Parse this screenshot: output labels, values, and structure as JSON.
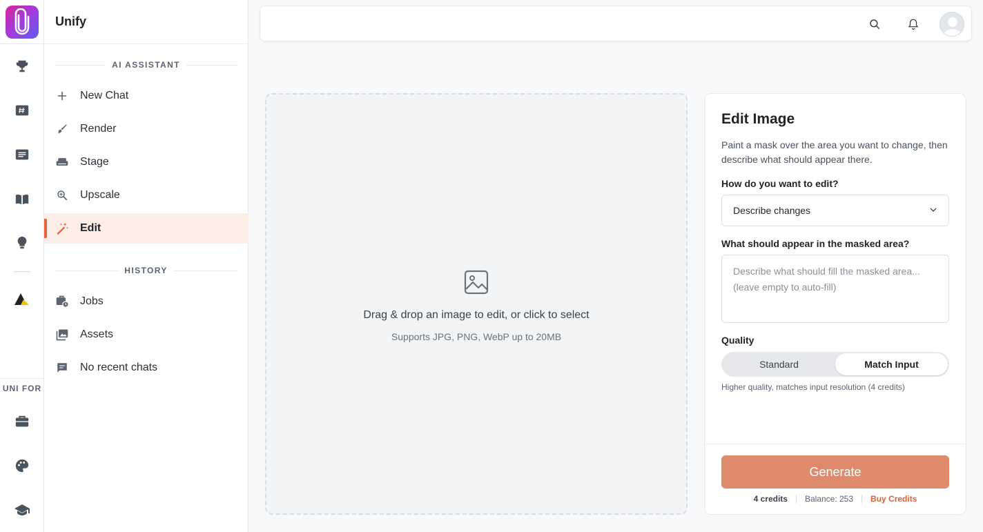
{
  "app": {
    "name": "Unify"
  },
  "rail": {
    "section_label": "UNI FOR",
    "icons": [
      "trophy-icon",
      "hashtag-card-icon",
      "news-icon",
      "book-icon",
      "lightbulb-icon",
      "triangle-logo-icon",
      "briefcase-icon",
      "palette-icon",
      "graduation-cap-icon"
    ]
  },
  "sidebar": {
    "ai_section": "AI ASSISTANT",
    "history_section": "HISTORY",
    "items": [
      {
        "label": "New Chat",
        "icon": "plus-icon"
      },
      {
        "label": "Render",
        "icon": "brush-icon"
      },
      {
        "label": "Stage",
        "icon": "sofa-icon"
      },
      {
        "label": "Upscale",
        "icon": "zoom-in-icon"
      },
      {
        "label": "Edit",
        "icon": "magic-wand-icon",
        "active": true
      }
    ],
    "history": [
      {
        "label": "Jobs",
        "icon": "jobs-icon"
      },
      {
        "label": "Assets",
        "icon": "photo-library-icon"
      },
      {
        "label": "No recent chats",
        "icon": "chat-icon"
      }
    ]
  },
  "topbar": {
    "icons": [
      "search-icon",
      "bell-icon",
      "avatar"
    ]
  },
  "dropzone": {
    "title": "Drag & drop an image to edit, or click to select",
    "subtitle": "Supports JPG, PNG, WebP up to 20MB"
  },
  "panel": {
    "title": "Edit Image",
    "description": "Paint a mask over the area you want to change, then describe what should appear there.",
    "mode_label": "How do you want to edit?",
    "mode_value": "Describe changes",
    "prompt_label": "What should appear in the masked area?",
    "prompt_value": "",
    "prompt_placeholder": "Describe what should fill the masked area... (leave empty to auto-fill)",
    "quality_label": "Quality",
    "quality_options": [
      "Standard",
      "Match Input"
    ],
    "quality_selected": "Match Input",
    "quality_hint": "Higher quality, matches input resolution (4 credits)",
    "generate_label": "Generate",
    "cost": "4 credits",
    "balance": "Balance: 253",
    "buy_label": "Buy Credits"
  },
  "colors": {
    "accent": "#e8603c",
    "generate": "#dd8b6c",
    "active_bg": "#fdeee8"
  }
}
